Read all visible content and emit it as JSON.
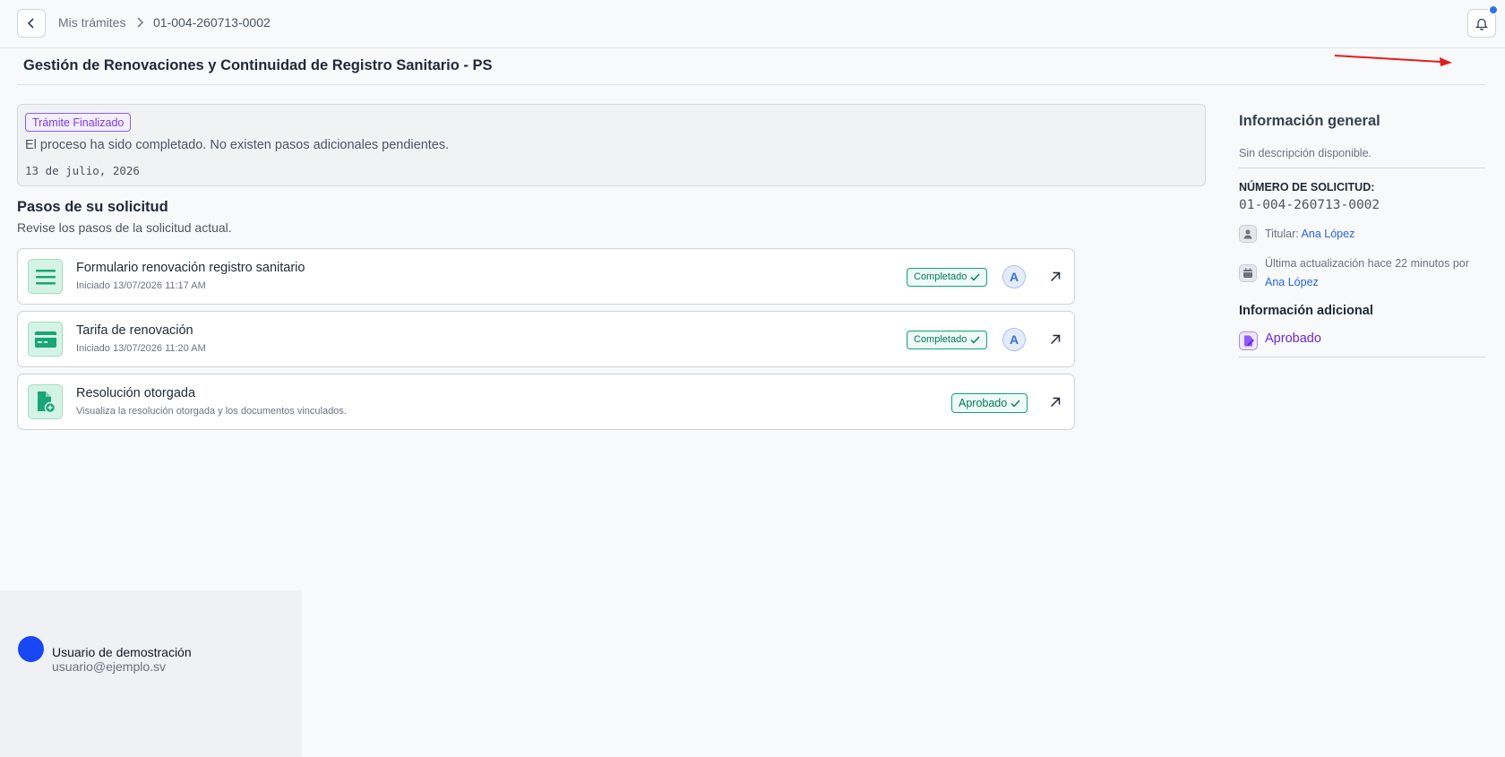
{
  "breadcrumb": {
    "link_label": "Mis trámites",
    "current": "01-004-260713-0002"
  },
  "page": {
    "title": "Gestión de Renovaciones y Continuidad de Registro Sanitario - PS"
  },
  "status": {
    "badge": "Trámite Finalizado",
    "message": "El proceso ha sido completado. No existen pasos adicionales pendientes.",
    "date": "13 de julio, 2026"
  },
  "steps_section": {
    "title": "Pasos de su solicitud",
    "subtitle": "Revise los pasos de la solicitud actual."
  },
  "steps": [
    {
      "name": "Formulario renovación registro sanitario",
      "meta": "Iniciado 13/07/2026 11:17 AM",
      "status": "Completado",
      "assignee_initial": "A",
      "icon": "form-lines-icon"
    },
    {
      "name": "Tarifa de renovación",
      "meta": "Iniciado 13/07/2026 11:20 AM",
      "status": "Completado",
      "assignee_initial": "A",
      "icon": "credit-card-icon"
    },
    {
      "name": "Resolución otorgada",
      "meta": "Visualiza la resolución otorgada y los documentos vinculados.",
      "status": "Aprobado",
      "icon": "document-plus-icon"
    }
  ],
  "info": {
    "title": "Información general",
    "description": "Sin descripción disponible.",
    "request_label": "NÚMERO DE SOLICITUD:",
    "request_number": "01-004-260713-0002",
    "holder_label": "Titular:",
    "holder_name": "Ana López",
    "updated_text": "Última actualización hace 22 minutos por",
    "updated_by": "Ana López",
    "extra_title": "Información adicional",
    "extra_status": "Aprobado"
  },
  "user": {
    "name": "Usuario de demostración",
    "email": "usuario@ejemplo.sv"
  },
  "colors": {
    "accent_green": "#10a37a",
    "accent_purple": "#7c3aed",
    "link_blue": "#2563eb",
    "user_avatar": "#1947f5",
    "annotation_arrow": "#e11d1d"
  }
}
